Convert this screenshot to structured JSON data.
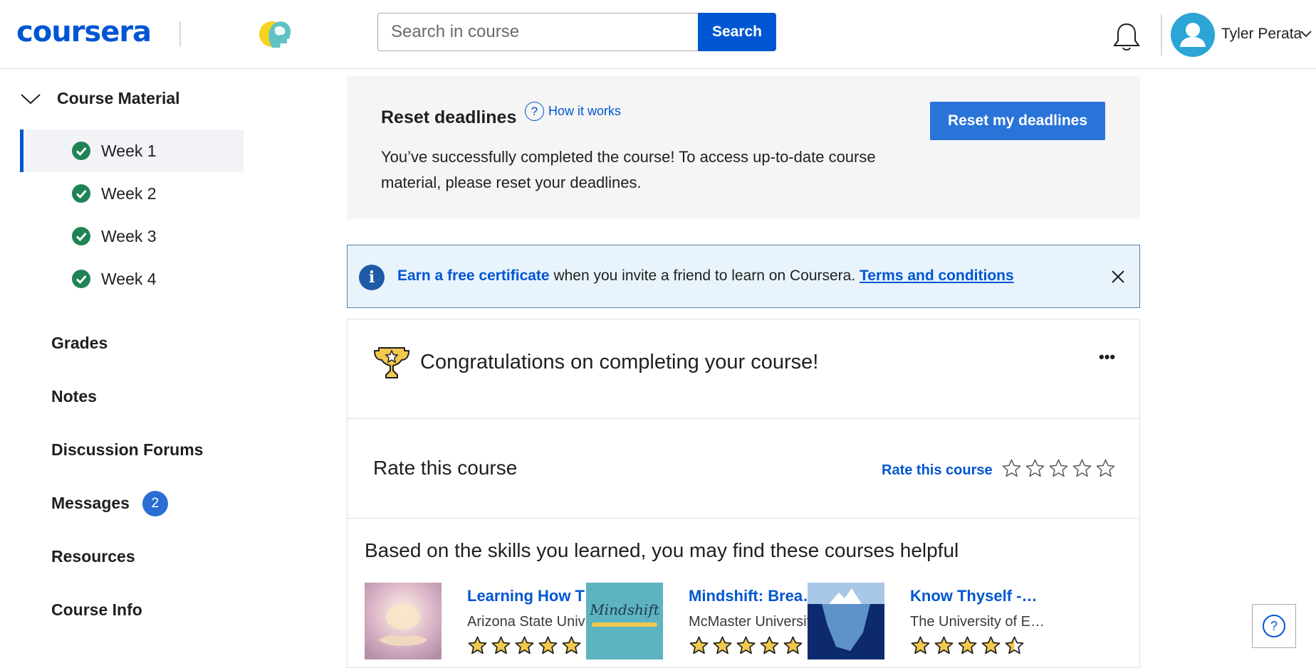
{
  "header": {
    "logo_text": "coursera",
    "search_placeholder": "Search in course",
    "search_button": "Search",
    "user_name": "Tyler Perata"
  },
  "sidebar": {
    "course_material_label": "Course Material",
    "weeks": [
      {
        "label": "Week 1",
        "completed": true,
        "active": true
      },
      {
        "label": "Week 2",
        "completed": true,
        "active": false
      },
      {
        "label": "Week 3",
        "completed": true,
        "active": false
      },
      {
        "label": "Week 4",
        "completed": true,
        "active": false
      }
    ],
    "nav": [
      {
        "label": "Grades"
      },
      {
        "label": "Notes"
      },
      {
        "label": "Discussion Forums"
      },
      {
        "label": "Messages",
        "badge": "2"
      },
      {
        "label": "Resources"
      },
      {
        "label": "Course Info"
      }
    ]
  },
  "reset": {
    "title": "Reset deadlines",
    "how_it_works": "How it works",
    "description": "You’ve successfully completed the course! To access up-to-date course material, please reset your deadlines.",
    "button": "Reset my deadlines"
  },
  "certificate_banner": {
    "link": "Earn a free certificate",
    "text": " when you invite a friend to learn on Coursera. ",
    "terms": "Terms and conditions"
  },
  "congrats": {
    "text": "Congratulations on completing your course!",
    "more": "•••"
  },
  "rating": {
    "title": "Rate this course",
    "link": "Rate this course",
    "max_stars": 5,
    "current": 0
  },
  "recommendations": {
    "title": "Based on the skills you learned, you may find these courses helpful",
    "items": [
      {
        "name": "Learning How T…",
        "org": "Arizona State Univ…",
        "rating": 5
      },
      {
        "name": "Mindshift: Brea…",
        "org": "McMaster University",
        "rating": 5,
        "thumb_text": "Mindshift"
      },
      {
        "name": "Know Thyself -…",
        "org": "The University of E…",
        "rating": 4.5
      }
    ]
  },
  "colors": {
    "brand": "#0056d2",
    "success": "#1f8354",
    "star_fill": "#f2c94c",
    "banner_bg": "#e8f3fc"
  }
}
